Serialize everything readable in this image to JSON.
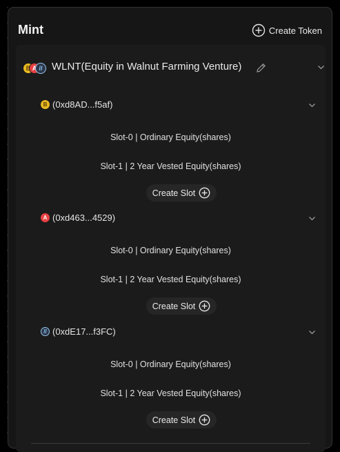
{
  "header": {
    "title": "Mint",
    "create_token_label": "Create Token"
  },
  "token": {
    "name": "WLNT(Equity in Walnut Farming Venture)",
    "logos": [
      {
        "icon": "coin-gold-icon",
        "color": "#e8b923",
        "glyph": "B"
      },
      {
        "icon": "avalanche-icon",
        "color": "#e84142",
        "glyph": "A"
      },
      {
        "icon": "arbitrum-icon",
        "color": "#4a90d9",
        "glyph": "//"
      }
    ]
  },
  "chains": [
    {
      "address": "(0xd8AD...f5af)",
      "logo": {
        "icon": "bnb-icon",
        "color": "#e8b923",
        "glyph": "B"
      },
      "slots": [
        "Slot-0 | Ordinary Equity(shares)",
        "Slot-1 | 2 Year Vested Equity(shares)"
      ],
      "create_slot_label": "Create Slot"
    },
    {
      "address": "(0xd463...4529)",
      "logo": {
        "icon": "avalanche-icon",
        "color": "#e84142",
        "glyph": "A"
      },
      "slots": [
        "Slot-0 | Ordinary Equity(shares)",
        "Slot-1 | 2 Year Vested Equity(shares)"
      ],
      "create_slot_label": "Create Slot"
    },
    {
      "address": "(0xdE17...f3FC)",
      "logo": {
        "icon": "arbitrum-icon",
        "color": "#4a90d9",
        "glyph": "//"
      },
      "slots": [
        "Slot-0 | Ordinary Equity(shares)",
        "Slot-1 | 2 Year Vested Equity(shares)"
      ],
      "create_slot_label": "Create Slot"
    }
  ]
}
